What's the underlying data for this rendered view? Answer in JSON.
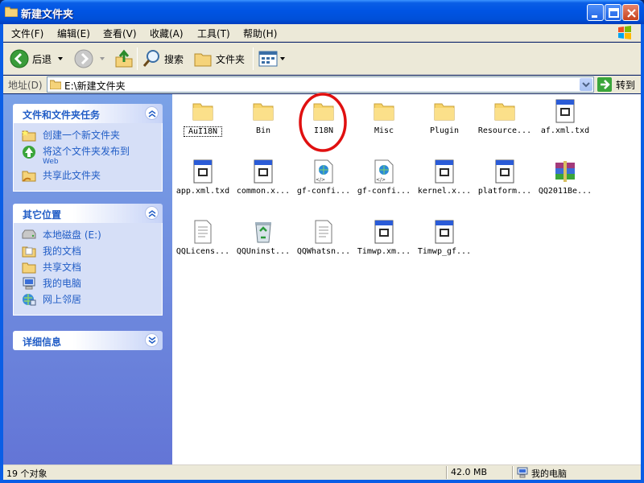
{
  "window": {
    "title": "新建文件夹"
  },
  "menu": [
    {
      "label": "文件(F)"
    },
    {
      "label": "编辑(E)"
    },
    {
      "label": "查看(V)"
    },
    {
      "label": "收藏(A)"
    },
    {
      "label": "工具(T)"
    },
    {
      "label": "帮助(H)"
    }
  ],
  "toolbar": {
    "back": "后退",
    "search": "搜索",
    "folders": "文件夹"
  },
  "address": {
    "label": "地址(D)",
    "path": "E:\\新建文件夹",
    "go": "转到"
  },
  "panels": {
    "tasks": {
      "title": "文件和文件夹任务",
      "items": [
        {
          "label": "创建一个新文件夹",
          "icon": "new-folder-icon"
        },
        {
          "label": "将这个文件夹发布到",
          "sub": "Web",
          "icon": "publish-web-icon"
        },
        {
          "label": "共享此文件夹",
          "icon": "share-folder-icon"
        }
      ]
    },
    "places": {
      "title": "其它位置",
      "items": [
        {
          "label": "本地磁盘 (E:)",
          "icon": "drive-icon"
        },
        {
          "label": "我的文档",
          "icon": "my-documents-icon"
        },
        {
          "label": "共享文档",
          "icon": "shared-documents-icon"
        },
        {
          "label": "我的电脑",
          "icon": "my-computer-icon"
        },
        {
          "label": "网上邻居",
          "icon": "network-icon"
        }
      ]
    },
    "details": {
      "title": "详细信息"
    }
  },
  "files": [
    {
      "name": "AuI18N",
      "type": "folder",
      "selected": true
    },
    {
      "name": "Bin",
      "type": "folder"
    },
    {
      "name": "I18N",
      "type": "folder"
    },
    {
      "name": "Misc",
      "type": "folder"
    },
    {
      "name": "Plugin",
      "type": "folder"
    },
    {
      "name": "Resource...",
      "type": "folder"
    },
    {
      "name": "af.xml.txd",
      "type": "doc"
    },
    {
      "name": "app.xml.txd",
      "type": "doc"
    },
    {
      "name": "common.x...",
      "type": "doc"
    },
    {
      "name": "gf-confi...",
      "type": "xml"
    },
    {
      "name": "gf-confi...",
      "type": "xml"
    },
    {
      "name": "kernel.x...",
      "type": "doc"
    },
    {
      "name": "platform...",
      "type": "doc"
    },
    {
      "name": "QQ2011Be...",
      "type": "rar"
    },
    {
      "name": "QQLicens...",
      "type": "text"
    },
    {
      "name": "QQUninst...",
      "type": "recycle"
    },
    {
      "name": "QQWhatsn...",
      "type": "text"
    },
    {
      "name": "Timwp.xm...",
      "type": "doc"
    },
    {
      "name": "Timwp_gf...",
      "type": "doc"
    }
  ],
  "status": {
    "count": "19 个对象",
    "size": "42.0 MB",
    "location": "我的电脑"
  },
  "colors": {
    "titlebar": "#0054e3",
    "taskpane": "#7ba2e7",
    "annotation": "#e01010"
  }
}
